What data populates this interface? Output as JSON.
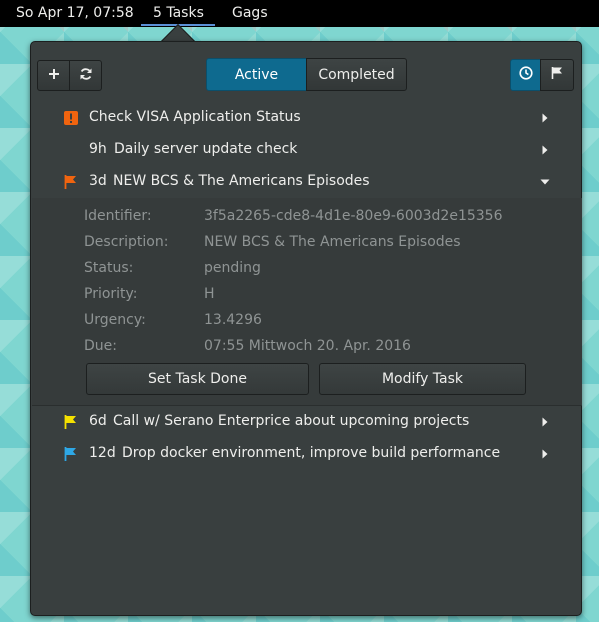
{
  "topbar": {
    "clock": "So Apr 17, 07:58",
    "tasks_label": "5 Tasks",
    "gags_label": "Gags",
    "underline_color": "#5b8fd6"
  },
  "toolbar": {
    "add_icon": "plus-icon",
    "refresh_icon": "refresh-icon",
    "tabs": [
      {
        "label": "Active",
        "selected": true
      },
      {
        "label": "Completed",
        "selected": false
      }
    ],
    "sort_urgency_icon": "clock-icon",
    "sort_priority_icon": "flag-icon",
    "accent_color": "#0e6a8f"
  },
  "tasks": [
    {
      "age": "",
      "title": "Check VISA Application Status",
      "icon": "warning-icon",
      "icon_color": "#f0640f",
      "expanded": false
    },
    {
      "age": "9h",
      "title": "Daily server update check",
      "icon": "",
      "icon_color": "",
      "expanded": false
    },
    {
      "age": "3d",
      "title": "NEW BCS & The Americans Episodes",
      "icon": "flag-icon",
      "icon_color": "#f0640f",
      "expanded": true
    },
    {
      "age": "6d",
      "title": "Call w/ Serano Enterprice about upcoming projects",
      "icon": "flag-icon",
      "icon_color": "#f5e100",
      "expanded": false
    },
    {
      "age": "12d",
      "title": "Drop docker environment, improve build performance",
      "icon": "flag-icon",
      "icon_color": "#2ea8e6",
      "expanded": false
    }
  ],
  "details": {
    "identifier_label": "Identifier:",
    "identifier": "3f5a2265-cde8-4d1e-80e9-6003d2e15356",
    "description_label": "Description:",
    "description": "NEW BCS & The Americans Episodes",
    "status_label": "Status:",
    "status": "pending",
    "priority_label": "Priority:",
    "priority": "H",
    "urgency_label": "Urgency:",
    "urgency": "13.4296",
    "due_label": "Due:",
    "due": "07:55 Mittwoch 20. Apr. 2016",
    "set_done_label": "Set Task Done",
    "modify_label": "Modify Task"
  }
}
